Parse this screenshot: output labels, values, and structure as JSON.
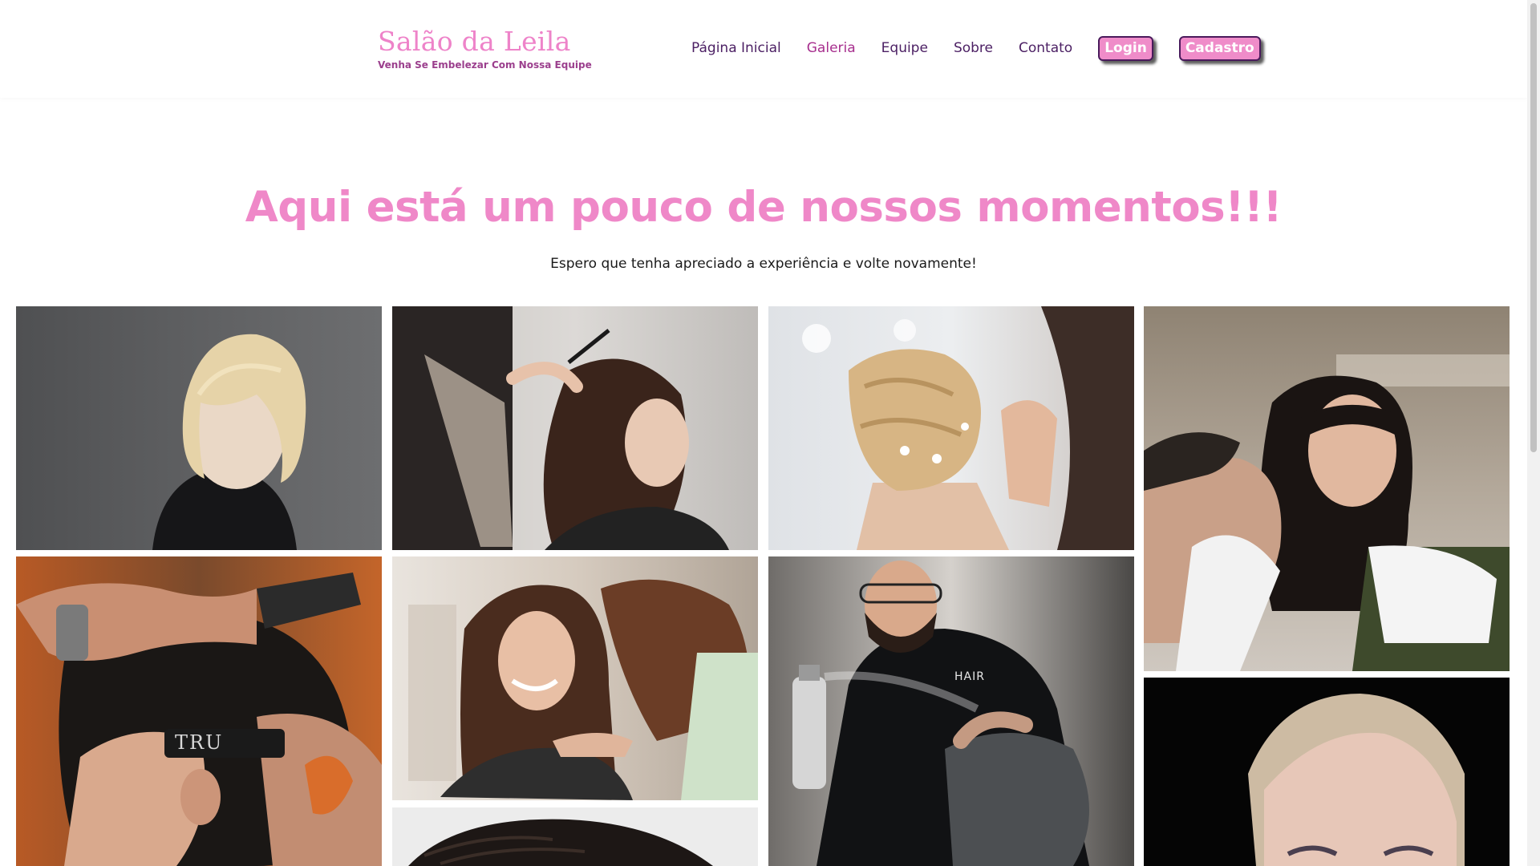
{
  "brand": {
    "title": "Salão da Leila",
    "subtitle": "Venha Se Embelezar Com Nossa Equipe"
  },
  "nav": {
    "items": [
      {
        "label": "Página Inicial",
        "active": false
      },
      {
        "label": "Galeria",
        "active": true
      },
      {
        "label": "Equipe",
        "active": false
      },
      {
        "label": "Sobre",
        "active": false
      },
      {
        "label": "Contato",
        "active": false
      }
    ],
    "login_label": "Login",
    "signup_label": "Cadastro"
  },
  "hero": {
    "title": "Aqui está um pouco de nossos momentos!!!",
    "subtitle": "Espero que tenha apreciado a experiência e volte novamente!"
  },
  "gallery": {
    "photos": [
      {
        "subject": "blonde-bob-woman-portrait"
      },
      {
        "subject": "stylist-combing-curly-hair"
      },
      {
        "subject": "bridal-updo-braids"
      },
      {
        "subject": "stylist-cutting-man-hair"
      },
      {
        "subject": "barber-razor-fade",
        "label": "TRU"
      },
      {
        "subject": "smiling-woman-long-hair"
      },
      {
        "subject": "barber-hairspray",
        "label": "HAIR"
      },
      {
        "subject": "woman-pixie-cut"
      },
      {
        "subject": "braided-hair-top"
      }
    ]
  },
  "colors": {
    "accent_pink": "#ef88c8",
    "brand_purple": "#4b1f63",
    "active_nav": "#a72f8e"
  }
}
